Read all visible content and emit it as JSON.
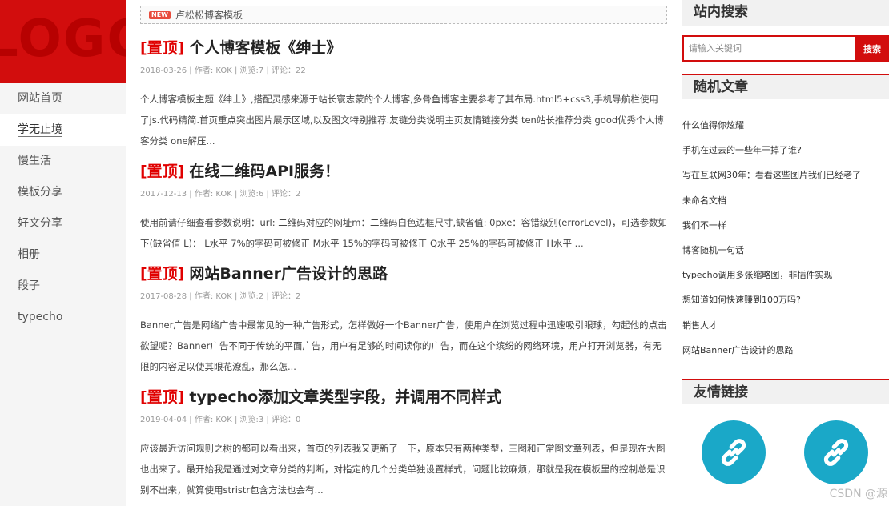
{
  "logo": {
    "text": "LOGO"
  },
  "nav": {
    "items": [
      {
        "label": "网站首页"
      },
      {
        "label": "学无止境"
      },
      {
        "label": "慢生活"
      },
      {
        "label": "模板分享"
      },
      {
        "label": "好文分享"
      },
      {
        "label": "相册"
      },
      {
        "label": "段子"
      },
      {
        "label": "typecho"
      }
    ]
  },
  "notice": {
    "badge": "NEW",
    "text": "卢松松博客模板"
  },
  "posts": [
    {
      "pin": "[置顶]",
      "title": "个人博客模板《绅士》",
      "meta": "2018-03-26 | 作者: KOK | 浏览:7 | 评论：22",
      "excerpt": "个人博客模板主题《绅士》,搭配灵感来源于站长寰志蒙的个人博客,多骨鱼博客主要参考了其布局.html5+css3,手机导航栏使用了js.代码精简.首页重点突出图片展示区域,以及图文特别推荐.友链分类说明主页友情链接分类 ten站长推荐分类 good优秀个人博客分类 one解压..."
    },
    {
      "pin": "[置顶]",
      "title": "在线二维码API服务！",
      "meta": "2017-12-13 | 作者: KOK | 浏览:6 | 评论：2",
      "excerpt": "使用前请仔细查看参数说明：url: 二维码对应的网址m：二维码白色边框尺寸,缺省值: 0pxe：容错级别(errorLevel)，可选参数如下(缺省值 L)： L水平 7%的字码可被修正 M水平 15%的字码可被修正 Q水平 25%的字码可被修正 H水平 ..."
    },
    {
      "pin": "[置顶]",
      "title": "网站Banner广告设计的思路",
      "meta": "2017-08-28 | 作者: KOK | 浏览:2 | 评论：2",
      "excerpt": "Banner广告是网络广告中最常见的一种广告形式，怎样做好一个Banner广告，使用户在浏览过程中迅速吸引眼球，勾起他的点击欲望呢？Banner广告不同于传统的平面广告，用户有足够的时间读你的广告，而在这个缤纷的网络环境，用户打开浏览器，有无限的内容足以使其眼花潦乱，那么怎..."
    },
    {
      "pin": "[置顶]",
      "title": "typecho添加文章类型字段，并调用不同样式",
      "meta": "2019-04-04 | 作者: KOK | 浏览:3 | 评论：0",
      "excerpt": "应该最近访问规则之树的都可以看出来，首页的列表我又更新了一下，原本只有两种类型，三图和正常图文章列表，但是现在大图也出来了。最开始我是通过对文章分类的判断，对指定的几个分类单独设置样式，问题比较麻烦，那就是我在模板里的控制总是识别不出来，就算使用stristr包含方法也会有..."
    }
  ],
  "sidebar": {
    "search": {
      "title": "站内搜索",
      "placeholder": "请输入关键词",
      "button": "搜索"
    },
    "random": {
      "title": "随机文章",
      "items": [
        "什么值得你炫耀",
        "手机在过去的一些年干掉了谁?",
        "写在互联网30年：看看这些图片我们已经老了",
        "未命名文档",
        "我们不一样",
        "博客随机一句话",
        "typecho调用多张缩略图，非插件实现",
        "想知道如何快速赚到100万吗?",
        "销售人才",
        "网站Banner广告设计的思路"
      ]
    },
    "links": {
      "title": "友情链接",
      "icons": [
        "link-icon",
        "link-icon"
      ],
      "color": "#1aa8c8"
    }
  },
  "watermark": "CSDN @源",
  "colors": {
    "accent": "#d20d0d",
    "link_icon_bg": "#1aa8c8"
  }
}
